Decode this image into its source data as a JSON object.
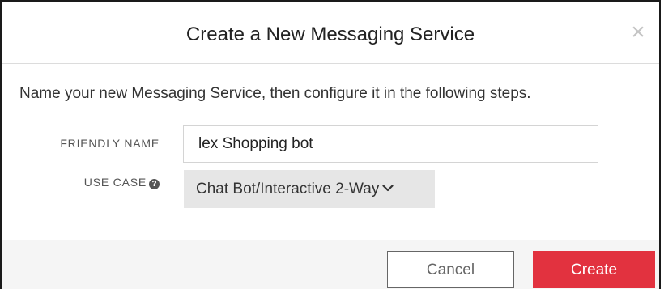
{
  "dialog": {
    "title": "Create a New Messaging Service",
    "close_icon": "close-icon",
    "close_glyph": "×"
  },
  "intro_text": "Name your new Messaging Service, then configure it in the following steps.",
  "form": {
    "friendly_name": {
      "label": "FRIENDLY NAME",
      "value": "lex Shopping bot"
    },
    "use_case": {
      "label": "USE CASE",
      "help_icon": "question-circle-icon",
      "help_glyph": "?",
      "selected": "Chat Bot/Interactive 2-Way",
      "chevron_icon": "chevron-down-icon"
    }
  },
  "footer": {
    "cancel_label": "Cancel",
    "create_label": "Create"
  },
  "colors": {
    "primary_button": "#e2323f",
    "select_background": "#e6e6e6",
    "footer_background": "#f5f5f5"
  }
}
